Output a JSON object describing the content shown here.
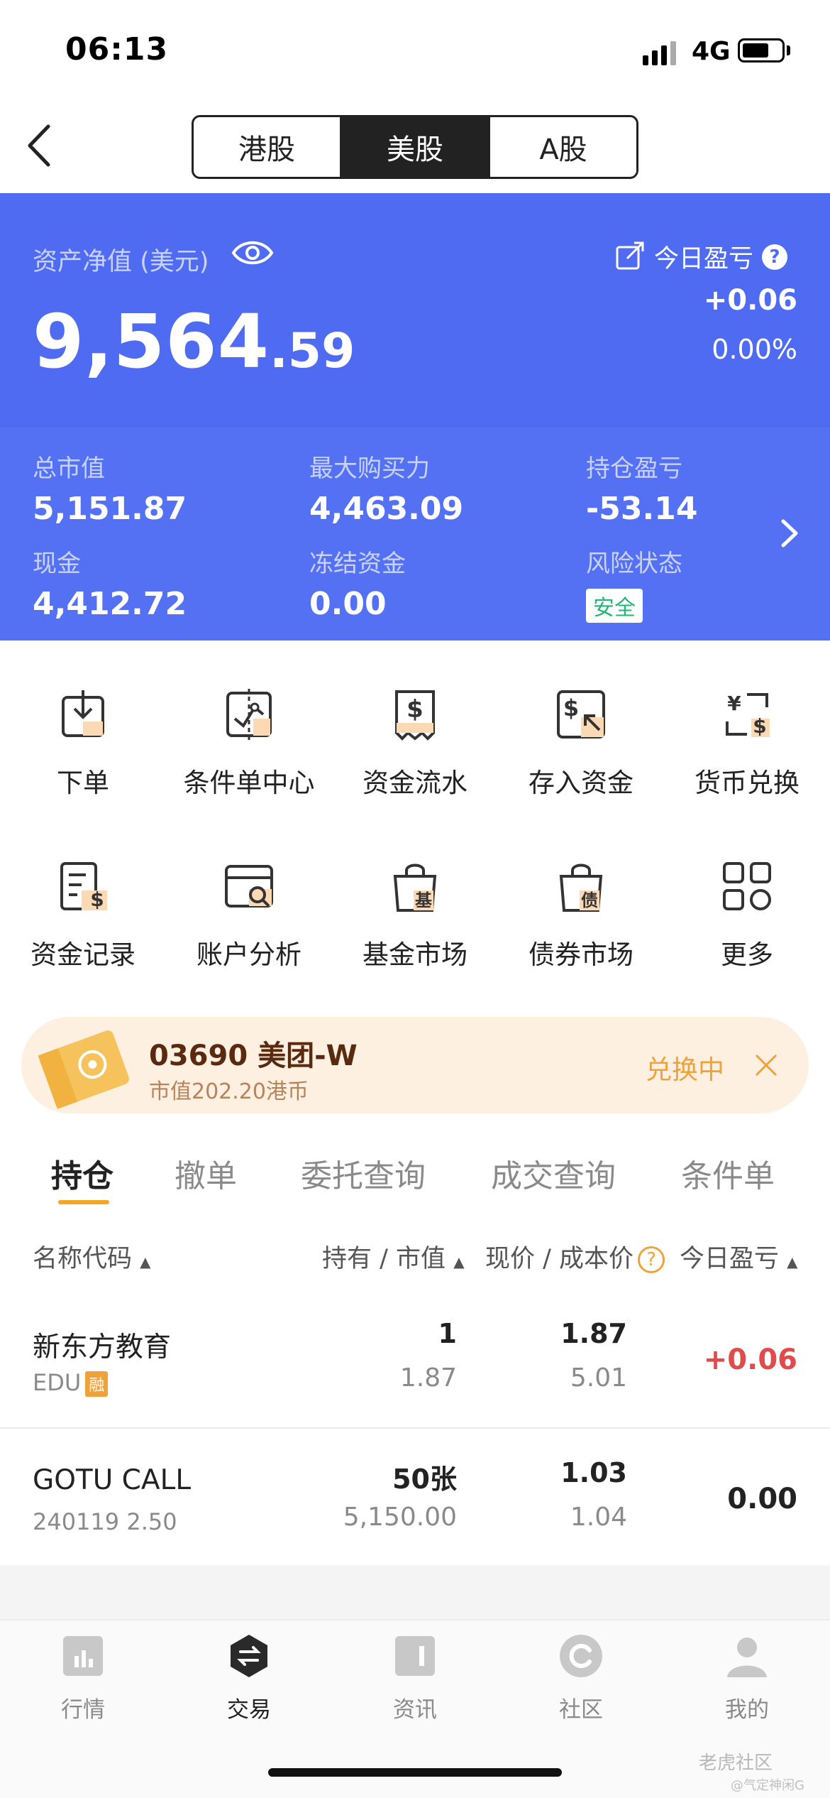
{
  "status_bar": {
    "time": "06:13",
    "network": "4G"
  },
  "segments": [
    {
      "label": "港股",
      "active": false
    },
    {
      "label": "美股",
      "active": true
    },
    {
      "label": "A股",
      "active": false
    }
  ],
  "asset": {
    "label": "资产净值 (美元)",
    "value_int": "9,564",
    "value_dec": ".59",
    "pnl_title": "今日盈亏",
    "pnl_amount": "+0.06",
    "pnl_percent": "0.00%"
  },
  "stats": {
    "total_market_label": "总市值",
    "total_market": "5,151.87",
    "buying_power_label": "最大购买力",
    "buying_power": "4,463.09",
    "position_pnl_label": "持仓盈亏",
    "position_pnl": "-53.14",
    "cash_label": "现金",
    "cash": "4,412.72",
    "frozen_label": "冻结资金",
    "frozen": "0.00",
    "risk_label": "风险状态",
    "risk": "安全"
  },
  "grid": [
    {
      "label": "下单",
      "icon": "download-tray-icon"
    },
    {
      "label": "条件单中心",
      "icon": "condition-order-icon"
    },
    {
      "label": "资金流水",
      "icon": "money-receipt-icon"
    },
    {
      "label": "存入资金",
      "icon": "deposit-icon"
    },
    {
      "label": "货币兑换",
      "icon": "currency-exchange-icon"
    },
    {
      "label": "资金记录",
      "icon": "fund-record-icon"
    },
    {
      "label": "账户分析",
      "icon": "account-analysis-icon"
    },
    {
      "label": "基金市场",
      "icon": "fund-market-icon"
    },
    {
      "label": "债券市场",
      "icon": "bond-market-icon"
    },
    {
      "label": "更多",
      "icon": "more-grid-icon"
    }
  ],
  "banner": {
    "title": "03690 美团-W",
    "subtitle": "市值202.20港币",
    "status": "兑换中"
  },
  "tabs": [
    "持仓",
    "撤单",
    "委托查询",
    "成交查询",
    "条件单"
  ],
  "table_header": {
    "name_code": "名称代码",
    "holding_value": "持有 / 市值",
    "price_cost": "现价 / 成本价",
    "today_pnl": "今日盈亏"
  },
  "rows": [
    {
      "name": "新东方教育",
      "code": "EDU",
      "badge": "融",
      "holding": "1",
      "market_value": "1.87",
      "price": "1.87",
      "cost": "5.01",
      "pnl": "+0.06",
      "pnl_color": "#e04b4b"
    },
    {
      "name": "GOTU CALL",
      "code": "240119 2.50",
      "badge": "",
      "holding": "50张",
      "market_value": "5,150.00",
      "price": "1.03",
      "cost": "1.04",
      "pnl": "0.00",
      "pnl_color": "#222222"
    }
  ],
  "bottom_nav": [
    {
      "label": "行情",
      "active": false
    },
    {
      "label": "交易",
      "active": true
    },
    {
      "label": "资讯",
      "active": false
    },
    {
      "label": "社区",
      "active": false
    },
    {
      "label": "我的",
      "active": false
    }
  ],
  "watermark": {
    "brand": "老虎社区",
    "user": "@气定神闲G"
  },
  "colors": {
    "primary": "#4f6bf1",
    "accent": "#f5a623",
    "up": "#e04b4b",
    "safe": "#22b573"
  }
}
